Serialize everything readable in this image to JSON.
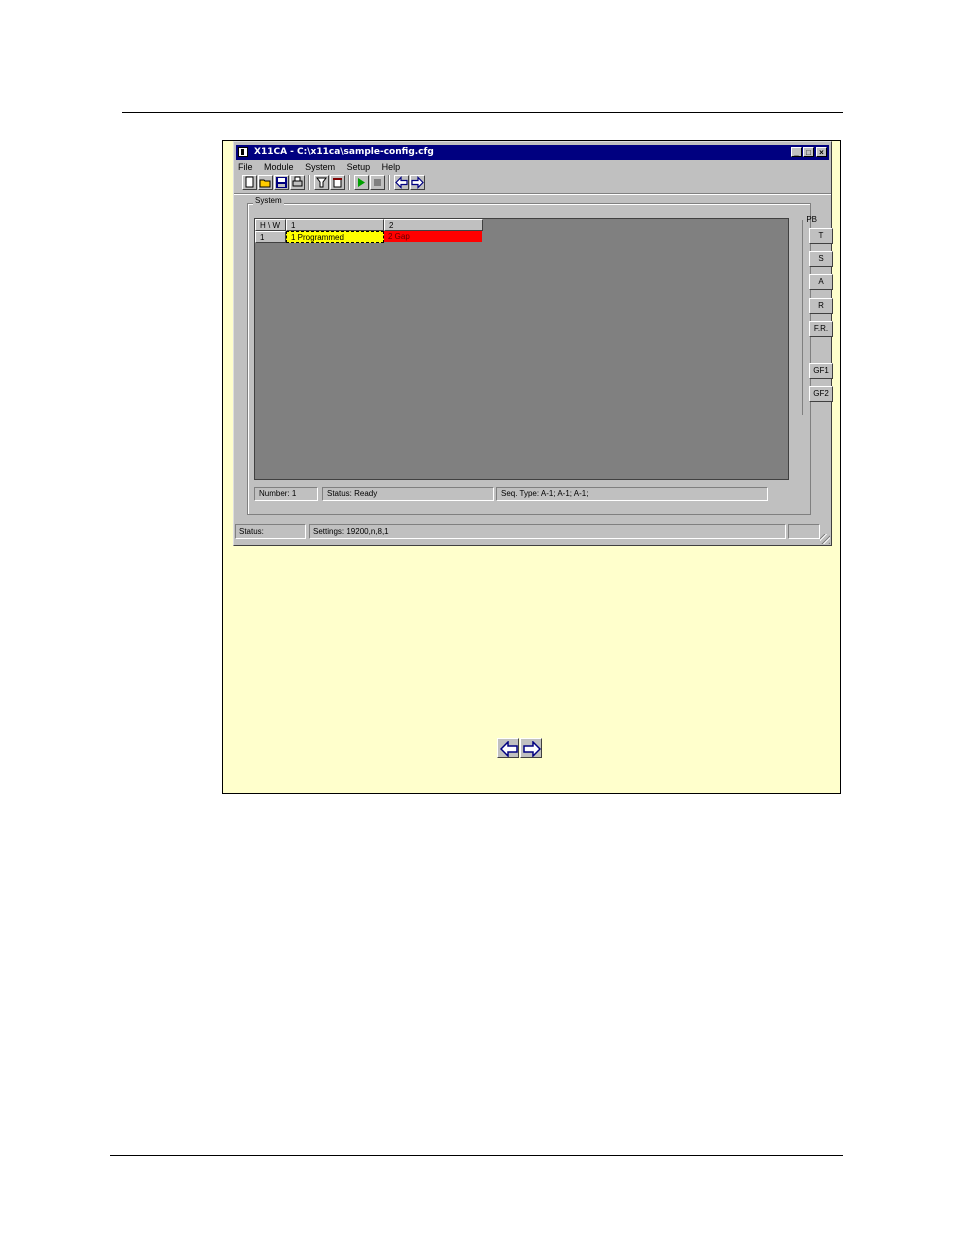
{
  "window": {
    "title": "X11CA - C:\\x11ca\\sample-config.cfg",
    "title_buttons": [
      "_",
      "□",
      "×"
    ]
  },
  "menu": {
    "items": [
      "File",
      "Module",
      "System",
      "Setup",
      "Help"
    ]
  },
  "toolbar": {
    "icons": [
      "new-icon",
      "open-icon",
      "save-icon",
      "print-icon",
      "filter-icon",
      "delete-icon",
      "run-icon",
      "stop-icon",
      "back-arrow-icon",
      "forward-arrow-icon"
    ]
  },
  "system": {
    "group_label": "System",
    "grid": {
      "headers": [
        "H \\ W",
        "1",
        "2"
      ],
      "rows": [
        {
          "label": "1",
          "cells": [
            {
              "text": "1 Programmed",
              "color": "#ffff00"
            },
            {
              "text": "2 Gap",
              "color": "#ff0000"
            }
          ]
        }
      ]
    },
    "status_fields": {
      "number": "Number: 1",
      "status": "Status: Ready",
      "seq_type": "Seq. Type: A-1; A-1; A-1;"
    }
  },
  "side_panel": {
    "label": "PB",
    "buttons": [
      "T",
      "S",
      "A",
      "R",
      "F.R.",
      "GF1",
      "GF2"
    ]
  },
  "statusbar": {
    "status": "Status:",
    "settings": "Settings: 19200,n,8,1"
  },
  "colors": {
    "titlebar": "#000080",
    "window_face": "#c0c0c0",
    "grid_background": "#808080",
    "figure_background": "#ffffcc"
  }
}
